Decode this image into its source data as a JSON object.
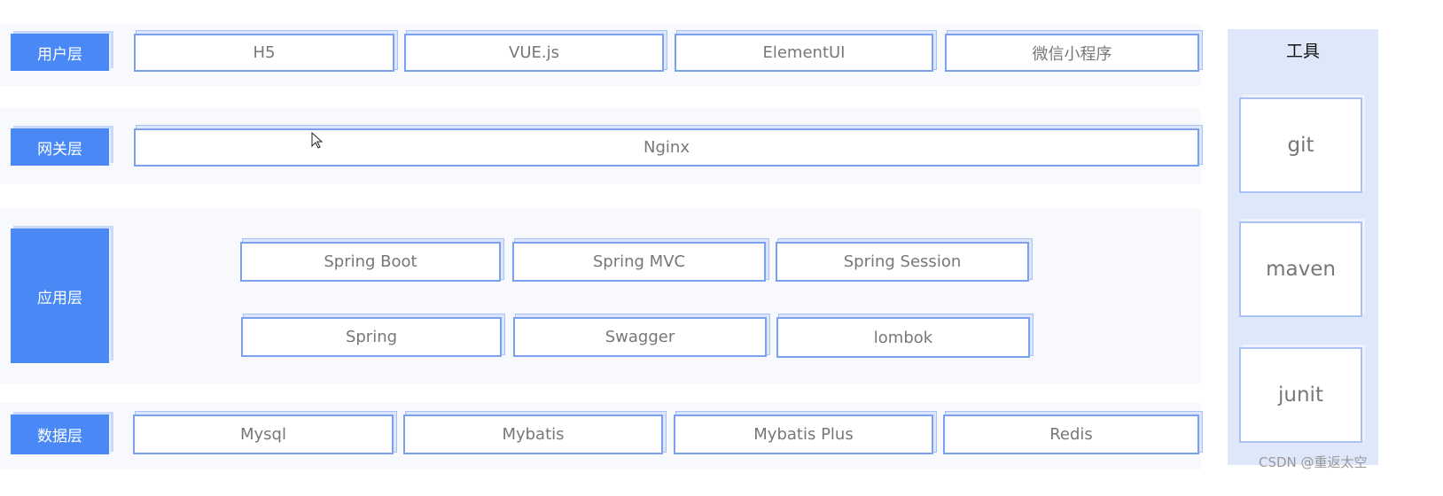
{
  "layers": [
    {
      "label": "用户层",
      "items": [
        "H5",
        "VUE.js",
        "ElementUI",
        "微信小程序"
      ]
    },
    {
      "label": "网关层",
      "items": [
        "Nginx"
      ]
    },
    {
      "label": "应用层",
      "items": [
        "Spring Boot",
        "Spring MVC",
        "Spring Session",
        "Spring",
        "Swagger",
        "lombok"
      ]
    },
    {
      "label": "数据层",
      "items": [
        "Mysql",
        "Mybatis",
        "Mybatis Plus",
        "Redis"
      ]
    }
  ],
  "tools": {
    "title": "工具",
    "items": [
      "git",
      "maven",
      "junit"
    ]
  },
  "watermark": "CSDN @重返太空",
  "colors": {
    "layer_label": "#4a89f5",
    "box_border": "#7aa0ee",
    "tools_bg": "#dfe7fb"
  }
}
